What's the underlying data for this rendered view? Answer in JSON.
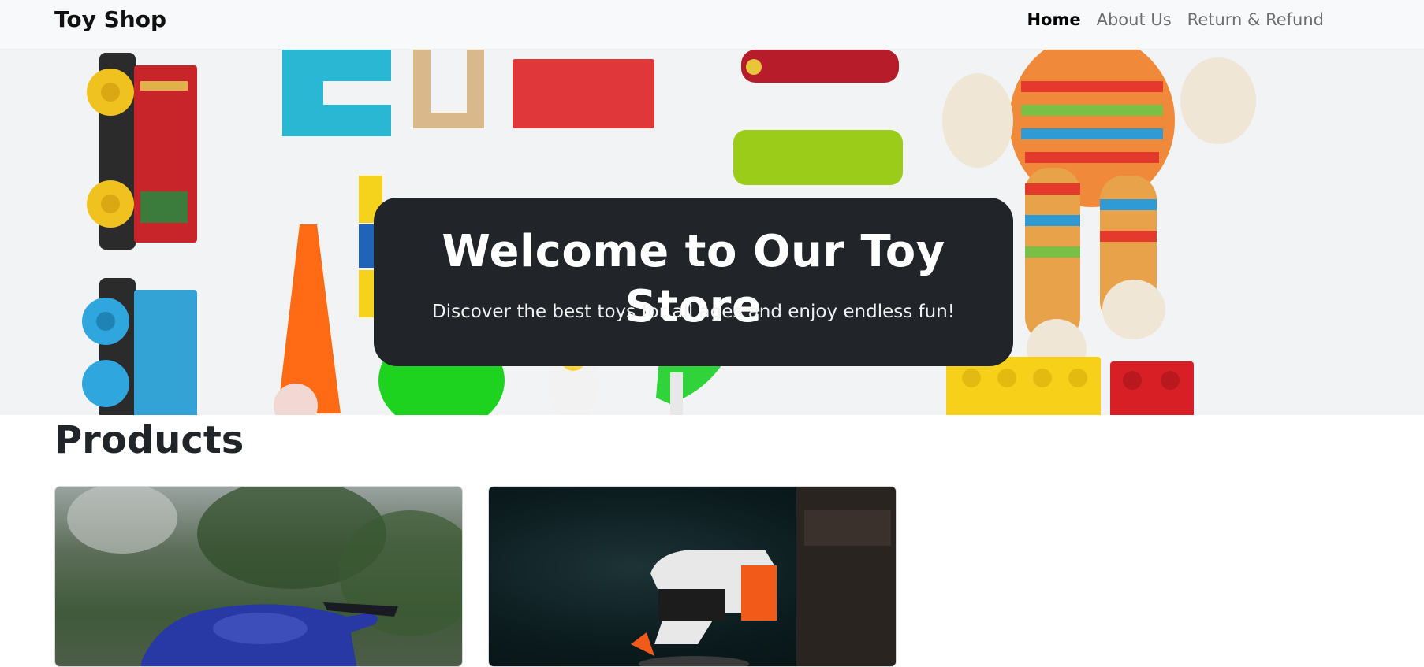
{
  "navbar": {
    "brand": "Toy Shop",
    "links": [
      {
        "label": "Home",
        "active": true
      },
      {
        "label": "About Us",
        "active": false
      },
      {
        "label": "Return & Refund",
        "active": false
      }
    ]
  },
  "hero": {
    "title": "Welcome to Our Toy Store",
    "subtitle": "Discover the best toys for all ages and enjoy endless fun!"
  },
  "products": {
    "heading": "Products",
    "items": [
      {
        "image": "blue toy car photo"
      },
      {
        "image": "nerf toy blaster photo"
      }
    ]
  },
  "colors": {
    "navbar_bg": "#f8f9fa",
    "hero_card_bg": "#212529",
    "text_dark": "#212529",
    "link_muted": "#6c6e70"
  }
}
